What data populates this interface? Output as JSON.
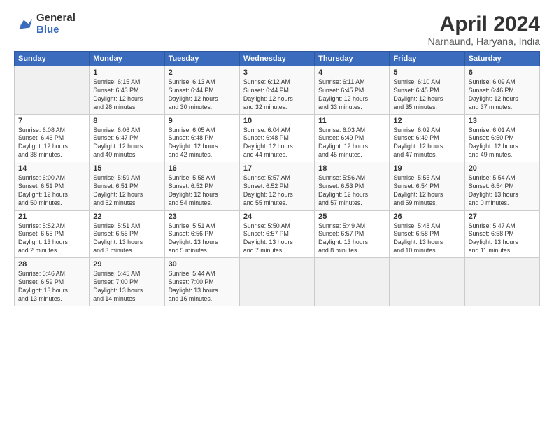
{
  "logo": {
    "general": "General",
    "blue": "Blue"
  },
  "title": "April 2024",
  "subtitle": "Narnaund, Haryana, India",
  "headers": [
    "Sunday",
    "Monday",
    "Tuesday",
    "Wednesday",
    "Thursday",
    "Friday",
    "Saturday"
  ],
  "weeks": [
    [
      {
        "num": "",
        "info": ""
      },
      {
        "num": "1",
        "info": "Sunrise: 6:15 AM\nSunset: 6:43 PM\nDaylight: 12 hours\nand 28 minutes."
      },
      {
        "num": "2",
        "info": "Sunrise: 6:13 AM\nSunset: 6:44 PM\nDaylight: 12 hours\nand 30 minutes."
      },
      {
        "num": "3",
        "info": "Sunrise: 6:12 AM\nSunset: 6:44 PM\nDaylight: 12 hours\nand 32 minutes."
      },
      {
        "num": "4",
        "info": "Sunrise: 6:11 AM\nSunset: 6:45 PM\nDaylight: 12 hours\nand 33 minutes."
      },
      {
        "num": "5",
        "info": "Sunrise: 6:10 AM\nSunset: 6:45 PM\nDaylight: 12 hours\nand 35 minutes."
      },
      {
        "num": "6",
        "info": "Sunrise: 6:09 AM\nSunset: 6:46 PM\nDaylight: 12 hours\nand 37 minutes."
      }
    ],
    [
      {
        "num": "7",
        "info": "Sunrise: 6:08 AM\nSunset: 6:46 PM\nDaylight: 12 hours\nand 38 minutes."
      },
      {
        "num": "8",
        "info": "Sunrise: 6:06 AM\nSunset: 6:47 PM\nDaylight: 12 hours\nand 40 minutes."
      },
      {
        "num": "9",
        "info": "Sunrise: 6:05 AM\nSunset: 6:48 PM\nDaylight: 12 hours\nand 42 minutes."
      },
      {
        "num": "10",
        "info": "Sunrise: 6:04 AM\nSunset: 6:48 PM\nDaylight: 12 hours\nand 44 minutes."
      },
      {
        "num": "11",
        "info": "Sunrise: 6:03 AM\nSunset: 6:49 PM\nDaylight: 12 hours\nand 45 minutes."
      },
      {
        "num": "12",
        "info": "Sunrise: 6:02 AM\nSunset: 6:49 PM\nDaylight: 12 hours\nand 47 minutes."
      },
      {
        "num": "13",
        "info": "Sunrise: 6:01 AM\nSunset: 6:50 PM\nDaylight: 12 hours\nand 49 minutes."
      }
    ],
    [
      {
        "num": "14",
        "info": "Sunrise: 6:00 AM\nSunset: 6:51 PM\nDaylight: 12 hours\nand 50 minutes."
      },
      {
        "num": "15",
        "info": "Sunrise: 5:59 AM\nSunset: 6:51 PM\nDaylight: 12 hours\nand 52 minutes."
      },
      {
        "num": "16",
        "info": "Sunrise: 5:58 AM\nSunset: 6:52 PM\nDaylight: 12 hours\nand 54 minutes."
      },
      {
        "num": "17",
        "info": "Sunrise: 5:57 AM\nSunset: 6:52 PM\nDaylight: 12 hours\nand 55 minutes."
      },
      {
        "num": "18",
        "info": "Sunrise: 5:56 AM\nSunset: 6:53 PM\nDaylight: 12 hours\nand 57 minutes."
      },
      {
        "num": "19",
        "info": "Sunrise: 5:55 AM\nSunset: 6:54 PM\nDaylight: 12 hours\nand 59 minutes."
      },
      {
        "num": "20",
        "info": "Sunrise: 5:54 AM\nSunset: 6:54 PM\nDaylight: 13 hours\nand 0 minutes."
      }
    ],
    [
      {
        "num": "21",
        "info": "Sunrise: 5:52 AM\nSunset: 6:55 PM\nDaylight: 13 hours\nand 2 minutes."
      },
      {
        "num": "22",
        "info": "Sunrise: 5:51 AM\nSunset: 6:55 PM\nDaylight: 13 hours\nand 3 minutes."
      },
      {
        "num": "23",
        "info": "Sunrise: 5:51 AM\nSunset: 6:56 PM\nDaylight: 13 hours\nand 5 minutes."
      },
      {
        "num": "24",
        "info": "Sunrise: 5:50 AM\nSunset: 6:57 PM\nDaylight: 13 hours\nand 7 minutes."
      },
      {
        "num": "25",
        "info": "Sunrise: 5:49 AM\nSunset: 6:57 PM\nDaylight: 13 hours\nand 8 minutes."
      },
      {
        "num": "26",
        "info": "Sunrise: 5:48 AM\nSunset: 6:58 PM\nDaylight: 13 hours\nand 10 minutes."
      },
      {
        "num": "27",
        "info": "Sunrise: 5:47 AM\nSunset: 6:58 PM\nDaylight: 13 hours\nand 11 minutes."
      }
    ],
    [
      {
        "num": "28",
        "info": "Sunrise: 5:46 AM\nSunset: 6:59 PM\nDaylight: 13 hours\nand 13 minutes."
      },
      {
        "num": "29",
        "info": "Sunrise: 5:45 AM\nSunset: 7:00 PM\nDaylight: 13 hours\nand 14 minutes."
      },
      {
        "num": "30",
        "info": "Sunrise: 5:44 AM\nSunset: 7:00 PM\nDaylight: 13 hours\nand 16 minutes."
      },
      {
        "num": "",
        "info": ""
      },
      {
        "num": "",
        "info": ""
      },
      {
        "num": "",
        "info": ""
      },
      {
        "num": "",
        "info": ""
      }
    ]
  ]
}
